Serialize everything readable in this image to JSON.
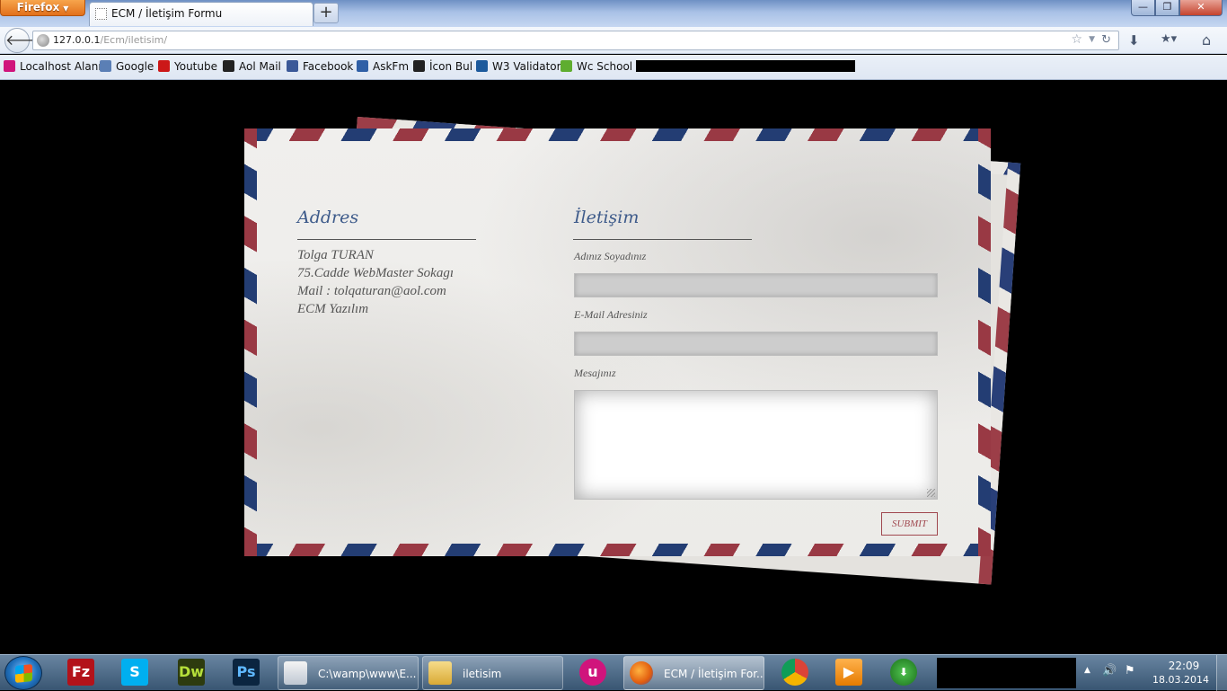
{
  "browser": {
    "app_button": "Firefox",
    "tab_title": "ECM / İletişim Formu",
    "new_tab": "+",
    "window_controls": {
      "minimize": "—",
      "maximize": "❐",
      "close": "✕"
    },
    "url_host": "127.0.0.1",
    "url_path": "/Ecm/iletisim/"
  },
  "bookmarks": [
    {
      "label": "Localhost Alanı",
      "icon": "wamp-icon",
      "color": "#d0147c"
    },
    {
      "label": "Google",
      "icon": "mail-icon",
      "color": "#5b7fb5"
    },
    {
      "label": "Youtube",
      "icon": "youtube-icon",
      "color": "#cc1818"
    },
    {
      "label": "Aol Mail",
      "icon": "aol-icon",
      "color": "#222222"
    },
    {
      "label": "Facebook",
      "icon": "facebook-icon",
      "color": "#3b5998"
    },
    {
      "label": "AskFm",
      "icon": "askfm-icon",
      "color": "#2f5fa6"
    },
    {
      "label": "İcon Bul",
      "icon": "iconbul-icon",
      "color": "#222222"
    },
    {
      "label": "W3 Validator",
      "icon": "w3-icon",
      "color": "#1d5a9c"
    },
    {
      "label": "Wc School",
      "icon": "w3schools-icon",
      "color": "#5fad2f"
    }
  ],
  "address": {
    "heading": "Addres",
    "lines": [
      "Tolga TURAN",
      "75.Cadde WebMaster Sokagı",
      "Mail : tolqaturan@aol.com",
      "ECM Yazılım"
    ]
  },
  "contact": {
    "heading": "İletişim",
    "name_label": "Adınız Soyadınız",
    "email_label": "E-Mail Adresiniz",
    "message_label": "Mesajınız",
    "name_value": "",
    "email_value": "",
    "message_value": "",
    "submit_label": "SUBMIT"
  },
  "taskbar": {
    "pinned": [
      {
        "name": "filezilla",
        "glyph": "Fz",
        "bg": "#b3121a",
        "fg": "#ffffff"
      },
      {
        "name": "skype",
        "glyph": "S",
        "bg": "#00aff0",
        "fg": "#ffffff"
      },
      {
        "name": "dreamweaver",
        "glyph": "Dw",
        "bg": "#2d3b0f",
        "fg": "#b6e03a"
      },
      {
        "name": "photoshop",
        "glyph": "Ps",
        "bg": "#0b2540",
        "fg": "#5fb8ff"
      }
    ],
    "tasks": [
      {
        "label": "C:\\wamp\\www\\E...",
        "icon": "notepad-icon"
      },
      {
        "label": "iletisim",
        "icon": "folder-icon"
      },
      {
        "label": "ECM / İletişim For...",
        "icon": "firefox-icon"
      }
    ],
    "clock_time": "22:09",
    "clock_date": "18.03.2014"
  }
}
